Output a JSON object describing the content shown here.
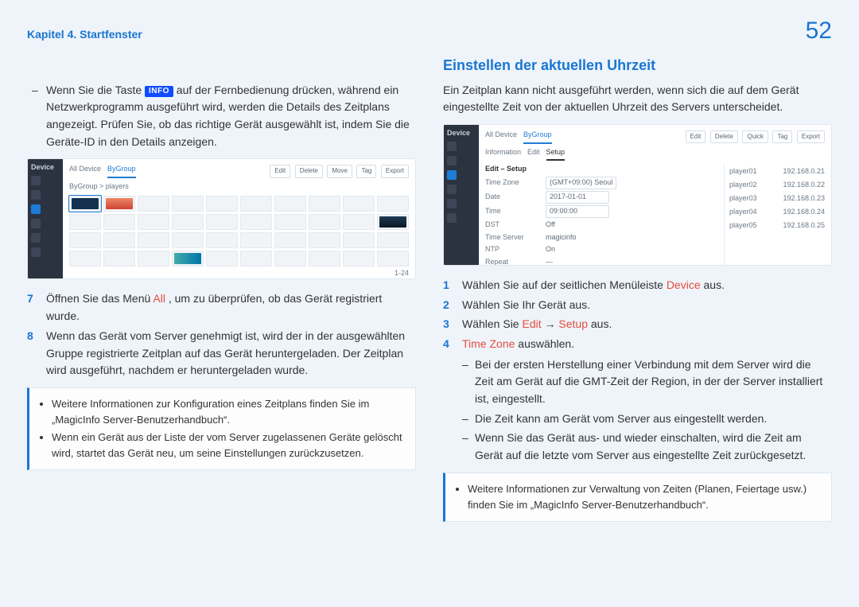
{
  "header": {
    "chapter": "Kapitel 4. Startfenster",
    "page_number": "52"
  },
  "left": {
    "dash_intro_before_badge": "Wenn Sie die Taste ",
    "info_badge": "INFO",
    "dash_intro_after_badge": " auf der Fernbedienung drücken, während ein Netzwerkprogramm ausgeführt wird, werden die Details des Zeitplans angezeigt. Prüfen Sie, ob das richtige Gerät ausgewählt ist, indem Sie die Geräte-ID in den Details anzeigen.",
    "shot": {
      "sidebar_title": "Device",
      "sidebar_items": [
        "Home",
        "Content",
        "Device",
        "User",
        "Rule",
        "Stat"
      ],
      "tabs": [
        "All Device",
        "ByGroup"
      ],
      "active_tab": "ByGroup",
      "toolbar_buttons": [
        "Edit",
        "Delete",
        "Move",
        "Tag",
        "Export"
      ],
      "breadcrumb": "ByGroup > players",
      "pager_end": "1-24"
    },
    "steps": [
      {
        "num": "7",
        "pre": "Öffnen Sie das Menü ",
        "hl": "All",
        "post": ", um zu überprüfen, ob das Gerät registriert wurde."
      },
      {
        "num": "8",
        "pre": "Wenn das Gerät vom Server genehmigt ist, wird der in der ausgewählten Gruppe registrierte Zeitplan auf das Gerät heruntergeladen. Der Zeitplan wird ausgeführt, nachdem er heruntergeladen wurde.",
        "hl": "",
        "post": ""
      }
    ],
    "note": {
      "items": [
        "Weitere Informationen zur Konfiguration eines Zeitplans finden Sie im „MagicInfo Server-Benutzerhandbuch“.",
        "Wenn ein Gerät aus der Liste der vom Server zugelassenen Geräte gelöscht wird, startet das Gerät neu, um seine Einstellungen zurückzusetzen."
      ]
    }
  },
  "right": {
    "section_title": "Einstellen der aktuellen Uhrzeit",
    "lead": "Ein Zeitplan kann nicht ausgeführt werden, wenn sich die auf dem Gerät eingestellte Zeit von der aktuellen Uhrzeit des Servers unterscheidet.",
    "shot": {
      "sidebar_title": "Device",
      "sidebar_items": [
        "Home",
        "Content",
        "Device",
        "User",
        "Rule",
        "Stat"
      ],
      "tabs": [
        "All Device",
        "ByGroup"
      ],
      "active_tab": "ByGroup",
      "toolbar_buttons": [
        "Edit",
        "Delete",
        "Quick",
        "Tag",
        "Export"
      ],
      "inner_tabs": [
        "Information",
        "Edit",
        "Setup"
      ],
      "inner_active": "Setup",
      "tz_title": "Edit – Setup",
      "fields": [
        {
          "lab": "Time Zone",
          "val": "(GMT+09:00) Seoul"
        },
        {
          "lab": "Date",
          "val": "2017-01-01"
        },
        {
          "lab": "Time",
          "val": "09:00:00"
        },
        {
          "lab": "DST",
          "val": "Off"
        },
        {
          "lab": "Time Server",
          "val": "magicinfo"
        },
        {
          "lab": "NTP",
          "val": "On"
        },
        {
          "lab": "Repeat",
          "val": "—"
        }
      ],
      "side_rows": [
        {
          "a": "player01",
          "b": "192.168.0.21"
        },
        {
          "a": "player02",
          "b": "192.168.0.22"
        },
        {
          "a": "player03",
          "b": "192.168.0.23"
        },
        {
          "a": "player04",
          "b": "192.168.0.24"
        },
        {
          "a": "player05",
          "b": "192.168.0.25"
        }
      ]
    },
    "steps": [
      {
        "num": "1",
        "pre": "Wählen Sie auf der seitlichen Menüleiste ",
        "hl": "Device",
        "post": " aus."
      },
      {
        "num": "2",
        "pre": "Wählen Sie Ihr Gerät aus.",
        "hl": "",
        "post": ""
      },
      {
        "num": "3",
        "pre": "Wählen Sie ",
        "hl": "Edit",
        "mid": " → ",
        "hl2": "Setup",
        "post": " aus."
      },
      {
        "num": "4",
        "pre": "",
        "hl": "Time Zone",
        "post": " auswählen."
      }
    ],
    "sub": [
      "Bei der ersten Herstellung einer Verbindung mit dem Server wird die Zeit am Gerät auf die GMT-Zeit der Region, in der der Server installiert ist, eingestellt.",
      "Die Zeit kann am Gerät vom Server aus eingestellt werden.",
      "Wenn Sie das Gerät aus- und wieder einschalten, wird die Zeit am Gerät auf die letzte vom Server aus eingestellte Zeit zurückgesetzt."
    ],
    "note": {
      "items": [
        "Weitere Informationen zur Verwaltung von Zeiten (Planen, Feiertage usw.) finden Sie im „MagicInfo Server-Benutzerhandbuch“."
      ]
    }
  }
}
